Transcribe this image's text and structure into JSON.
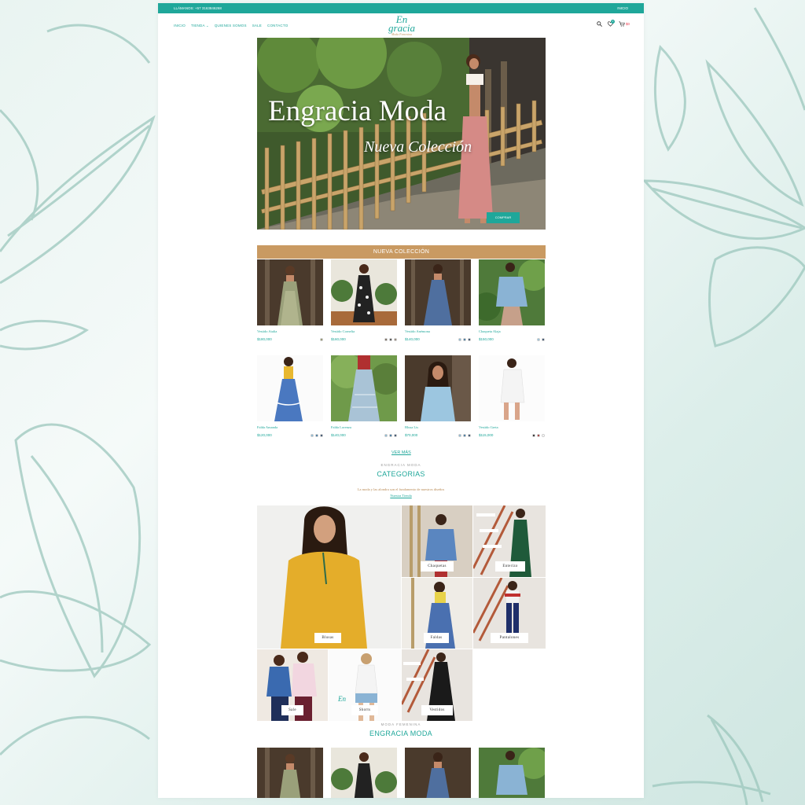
{
  "topbar": {
    "left": "LLÁMANOS: +57 3163846268",
    "right": "INICIO"
  },
  "nav": {
    "menu": [
      "INICIO",
      "TIENDA ⌄",
      "QUIENES SOMOS",
      "SALE",
      "CONTACTO"
    ],
    "logo_line1": "En",
    "logo_line2": "gracia",
    "logo_tag": "Moda Femenina",
    "cart_count": "0",
    "cart_total": "$0"
  },
  "hero": {
    "title": "Engracia Moda",
    "subtitle": "Nueva Colección",
    "button": "COMPRAR"
  },
  "new_collection": {
    "heading": "NUEVA COLECCIÓN",
    "products": [
      {
        "name": "Vestido Atalia",
        "price": "$180,000",
        "swatches": [
          "#8a8a5a"
        ]
      },
      {
        "name": "Vestido Cornelia",
        "price": "$160,000",
        "swatches": [
          "#6b5a4a",
          "#3a3a3a",
          "#8a7a6a"
        ]
      },
      {
        "name": "Vestido Anémona",
        "price": "$140,000",
        "swatches": [
          "#7fb7d6",
          "#2a6a9a",
          "#1f3b5c"
        ]
      },
      {
        "name": "Chaqueta Alaja",
        "price": "$150,000",
        "swatches": [
          "#8fc2de",
          "#1f3b5c"
        ]
      },
      {
        "name": "Falda Amanda",
        "price": "$120,000",
        "swatches": [
          "#7fb7d6",
          "#2a6a9a",
          "#1f3b5c"
        ]
      },
      {
        "name": "Falda Lorenza",
        "price": "$140,000",
        "swatches": [
          "#7fb7d6",
          "#2a6a9a",
          "#1f3b5c"
        ]
      },
      {
        "name": "Blusa Lis",
        "price": "$70,000",
        "swatches": [
          "#7fb7d6",
          "#2a6a9a",
          "#1f3b5c"
        ]
      },
      {
        "name": "Vestido Greta",
        "price": "$115,000",
        "swatches": [
          "#111111",
          "#a02020",
          "#ffffff"
        ]
      }
    ],
    "ver_mas": "VER MÁS"
  },
  "categories": {
    "pre": "ENGRACIA MODA",
    "heading": "CATEGORIAS",
    "description": "La moda y las alondra son el fundamento de nuestros diseños",
    "link": "Nuestra Tienda",
    "items": [
      "Blusas",
      "Chaquetas",
      "Enterizo",
      "Faldas",
      "Pantalones",
      "Sale",
      "Shorts",
      "Vestidos"
    ]
  },
  "bottom_section": {
    "pre": "MODA FEMENINA",
    "heading": "ENGRACIA MODA"
  },
  "colors": {
    "accent": "#1fa79a",
    "band": "#c99a62"
  }
}
